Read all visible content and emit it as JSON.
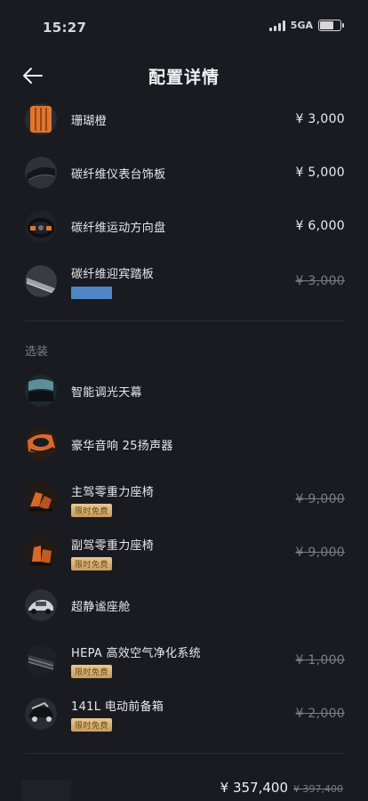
{
  "status": {
    "time": "15:27",
    "network": "5GA"
  },
  "header": {
    "title": "配置详情"
  },
  "config_items": [
    {
      "name": "珊瑚橙",
      "price": "¥ 3,000"
    },
    {
      "name": "碳纤维仪表台饰板",
      "price": "¥ 5,000"
    },
    {
      "name": "碳纤维运动方向盘",
      "price": "¥ 6,000"
    },
    {
      "name": "碳纤维迎宾踏板",
      "price": "¥ 3,000"
    }
  ],
  "options_section": {
    "label": "选装",
    "items": [
      {
        "name": "智能调光天幕",
        "price": ""
      },
      {
        "name": "豪华音响 25扬声器",
        "price": ""
      },
      {
        "name": "主驾零重力座椅",
        "tag": "限时免费",
        "price": "¥ 9,000"
      },
      {
        "name": "副驾零重力座椅",
        "tag": "限时免费",
        "price": "¥ 9,000"
      },
      {
        "name": "超静谧座舱",
        "price": ""
      },
      {
        "name": "HEPA 高效空气净化系统",
        "tag": "限时免费",
        "price": "¥ 1,000"
      },
      {
        "name": "141L 电动前备箱",
        "tag": "限时免费",
        "price": "¥ 2,000"
      }
    ]
  },
  "summary": {
    "total": "¥ 357,400",
    "original_total": "¥ 397,400"
  },
  "colors": {
    "background": "#1a1b21",
    "tag_gold": "#d9b377",
    "accent_orange": "#e0752d",
    "blue_bar": "#4f86c6"
  },
  "icons": {
    "back": "arrow-left-icon"
  }
}
